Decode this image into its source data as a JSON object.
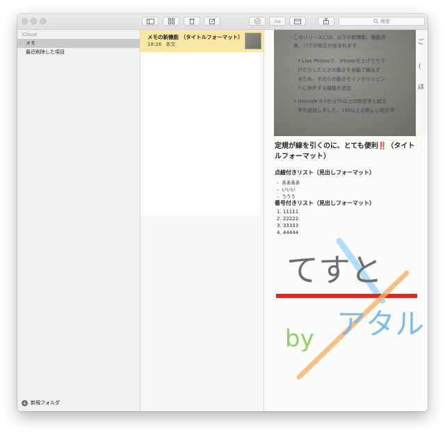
{
  "toolbar": {
    "search_placeholder": "検索",
    "buttons": [
      "sidebar-toggle-icon",
      "gallery-icon",
      "trash-icon",
      "compose-icon",
      "checklist-icon",
      "format-icon",
      "table-icon",
      "share-icon"
    ]
  },
  "sidebar": {
    "account": "iCloud",
    "items": [
      {
        "label": "メモ",
        "selected": true
      },
      {
        "label": "最近削除した項目",
        "selected": false
      }
    ],
    "new_folder": "新規フォルダ"
  },
  "note_list": [
    {
      "title": "メモの新機能 （タイトルフォーマット）",
      "time": "18:26",
      "preview": "本文"
    }
  ],
  "editor": {
    "photo_lines": [
      "このリリースには、以下の新機能、機能改",
      "善、バグの修正が含まれます",
      "• Live Photosで、iPhoneを上げたり下",
      "げたりしたときの動きを自動で検出す",
      "るため、それらの動きをインテリジェン",
      "トに除外する機能を追加",
      "• Unicode 9.0から70以上の新文字と絵文",
      "字を追加しました。150以上の新しい絵文字"
    ],
    "heading": "定規が線を引くのに、とても便利",
    "heading_mark": "‼️",
    "heading_suffix": "（タイトルフォーマット）",
    "bullet_title": "点線付きリスト（見出しフォーマット）",
    "bullets": [
      "ああああ",
      "いいい",
      "ううう"
    ],
    "numbered_title": "番号付きリスト（見出しフォーマット）",
    "numbered": [
      "1. 11111",
      "2. 22222",
      "3. 33333",
      "4. 44444"
    ],
    "bullet_dash": "–",
    "handwriting": {
      "word1": "てすと",
      "word2": "by",
      "word3": "アタル"
    }
  },
  "colors": {
    "selected_note": "#fbe7a3",
    "sidebar_selected": "#cacaca",
    "red_stroke": "#e82420",
    "blue_stroke": "#6fb7f0",
    "orange_stroke": "#f5a04a",
    "green_stroke": "#7ecf5a"
  }
}
